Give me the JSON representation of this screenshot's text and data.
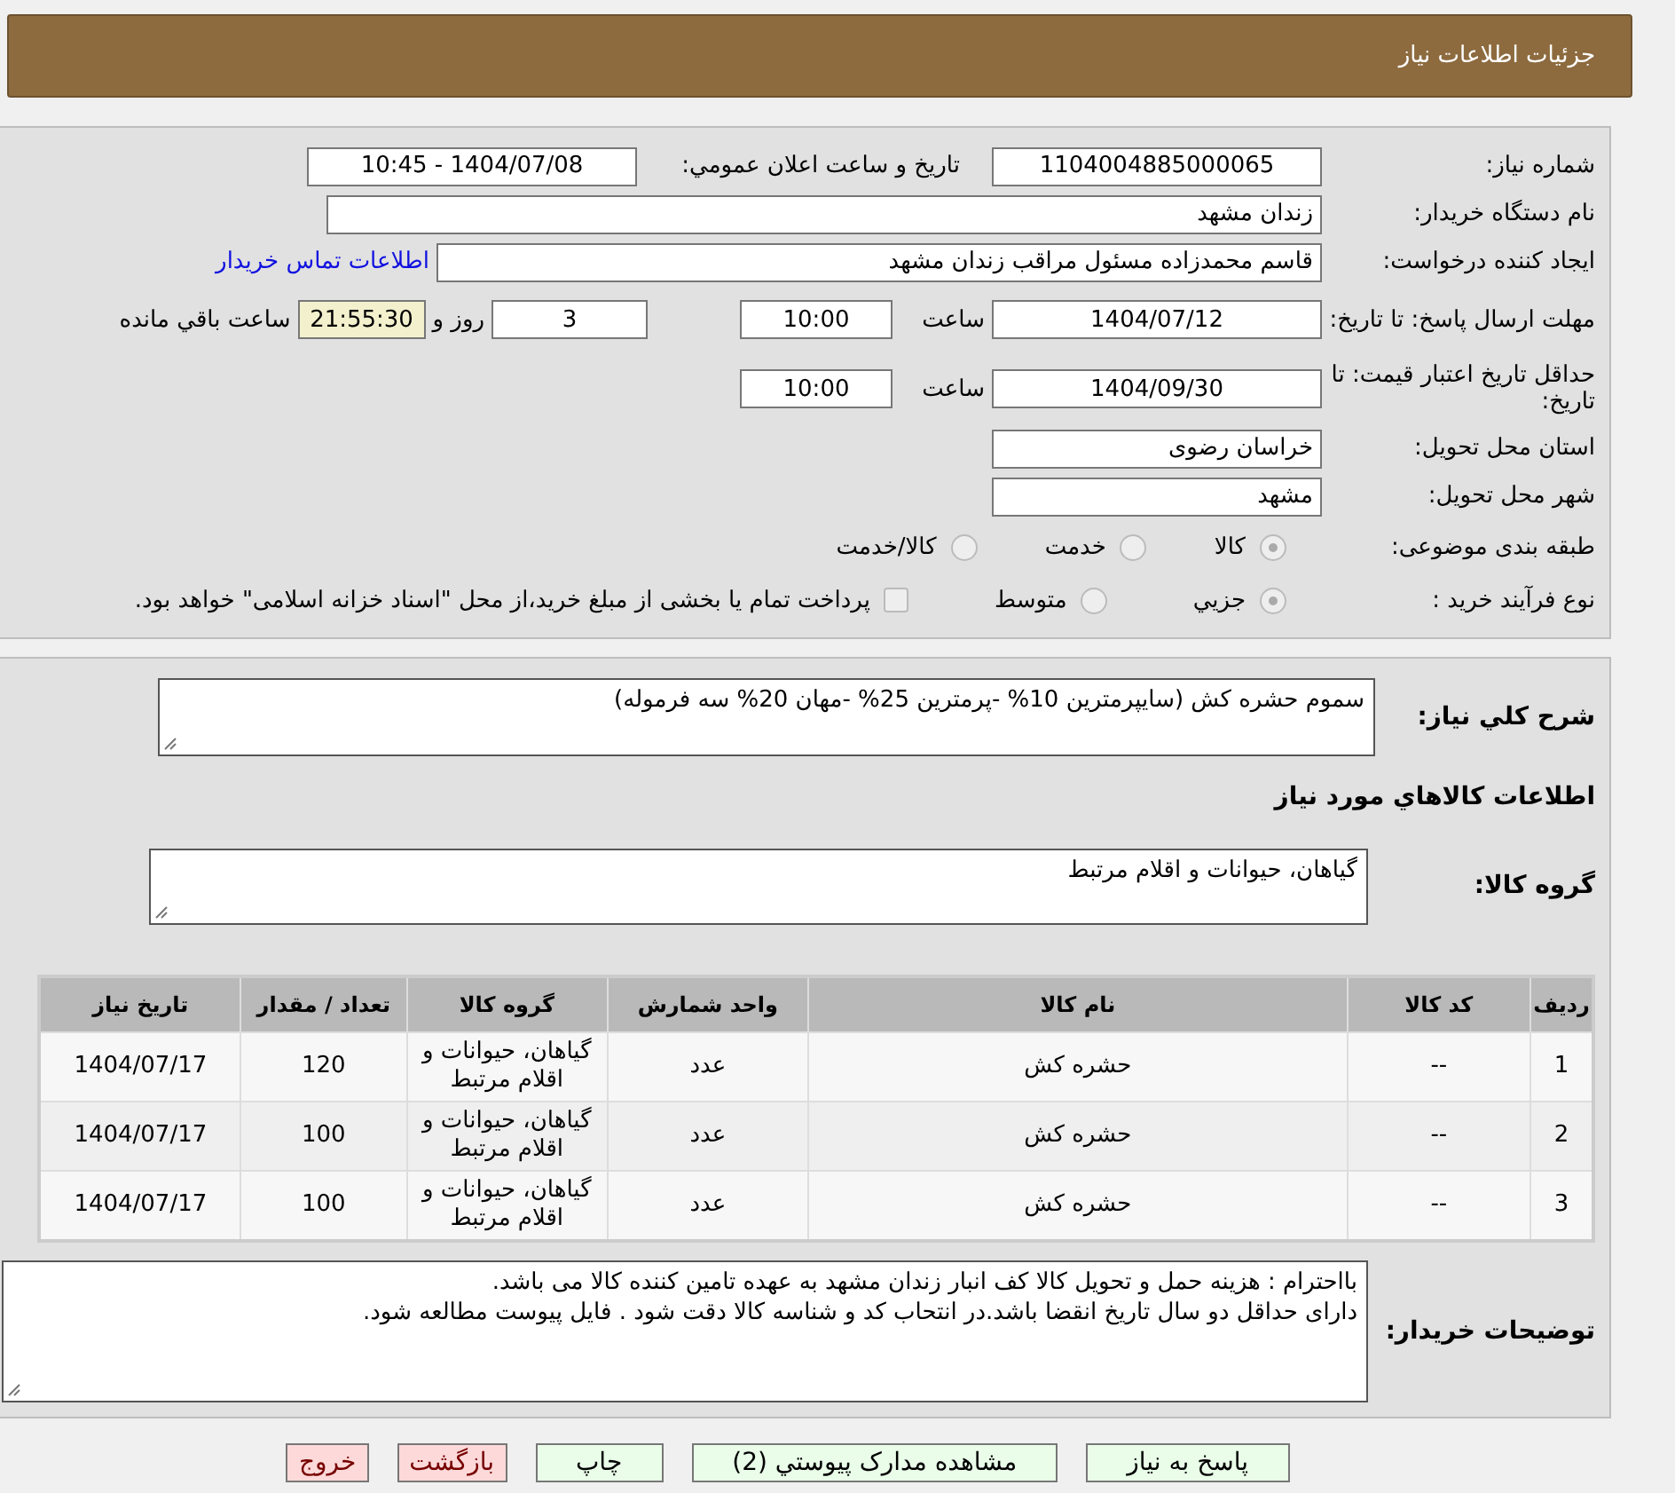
{
  "header": {
    "title": "جزئیات اطلاعات نیاز"
  },
  "need_number": {
    "label": "شماره نیاز:",
    "value": "1104004885000065"
  },
  "announce_datetime": {
    "label": "تاريخ و ساعت اعلان عمومي:",
    "value": "1404/07/08 - 10:45"
  },
  "buyer_org": {
    "label": "نام دستگاه خريدار:",
    "value": "زندان مشهد"
  },
  "requester": {
    "label": "ایجاد کننده درخواست:",
    "value": "قاسم محمدزاده مسئول مراقب زندان مشهد",
    "link": "اطلاعات تماس خریدار"
  },
  "reply_deadline": {
    "label": "مهلت ارسال پاسخ: تا تاریخ:",
    "date": "1404/07/12",
    "time_label": "ساعت",
    "time": "10:00",
    "days": "3",
    "days_label": "روز و",
    "remaining": "21:55:30",
    "remaining_label": "ساعت باقي مانده"
  },
  "price_validity": {
    "label": "حداقل تاريخ اعتبار قيمت: تا تاريخ:",
    "date": "1404/09/30",
    "time_label": "ساعت",
    "time": "10:00"
  },
  "province": {
    "label": "استان محل تحویل:",
    "value": "خراسان رضوی"
  },
  "city": {
    "label": "شهر محل تحویل:",
    "value": "مشهد"
  },
  "category": {
    "label": "طبقه بندی موضوعی:",
    "options": [
      {
        "label": "کالا",
        "selected": true
      },
      {
        "label": "خدمت",
        "selected": false
      },
      {
        "label": "کالا/خدمت",
        "selected": false
      }
    ]
  },
  "process": {
    "label": "نوع فرآیند خرید :",
    "options": [
      {
        "label": "جزيي",
        "selected": true
      },
      {
        "label": "متوسط",
        "selected": false
      }
    ],
    "treasury": {
      "label": "پرداخت تمام یا بخشی از مبلغ خرید،از محل \"اسناد خزانه اسلامی\" خواهد بود.",
      "checked": false
    }
  },
  "description": {
    "label": "شرح کلي نیاز:",
    "value": "سموم حشره کش (سایپرمترین 10% -پرمترین 25% -مهان 20% سه فرموله)"
  },
  "goods_heading": "اطلاعات کالاهاي مورد نیاز",
  "goods_group": {
    "label": "گروه کالا:",
    "value": "گیاهان، حیوانات و اقلام مرتبط"
  },
  "table": {
    "columns": [
      "ردیف",
      "کد کالا",
      "نام کالا",
      "واحد شمارش",
      "گروه کالا",
      "تعداد / مقدار",
      "تاريخ نیاز"
    ],
    "rows": [
      [
        "1",
        "--",
        "حشره کش",
        "عدد",
        "گیاهان، حیوانات و اقلام مرتبط",
        "120",
        "1404/07/17"
      ],
      [
        "2",
        "--",
        "حشره کش",
        "عدد",
        "گیاهان، حیوانات و اقلام مرتبط",
        "100",
        "1404/07/17"
      ],
      [
        "3",
        "--",
        "حشره کش",
        "عدد",
        "گیاهان، حیوانات و اقلام مرتبط",
        "100",
        "1404/07/17"
      ]
    ]
  },
  "buyer_notes": {
    "label": "توضیحات خریدار:",
    "lines": [
      "بااحترام : هزینه حمل و تحویل کالا کف انبار زندان مشهد به عهده تامین کننده کالا می باشد.",
      "دارای حداقل دو سال تاریخ انقضا باشد.در انتحاب کد و شناسه کالا دقت شود . فایل پیوست مطالعه شود."
    ]
  },
  "buttons": [
    {
      "label": "پاسخ به نیاز",
      "kind": "normal"
    },
    {
      "label": "مشاهده مدارک پیوستي (2)",
      "kind": "normal"
    },
    {
      "label": "چاپ",
      "kind": "normal"
    },
    {
      "label": "بازگشت",
      "kind": "danger"
    },
    {
      "label": "خروج",
      "kind": "danger"
    }
  ]
}
